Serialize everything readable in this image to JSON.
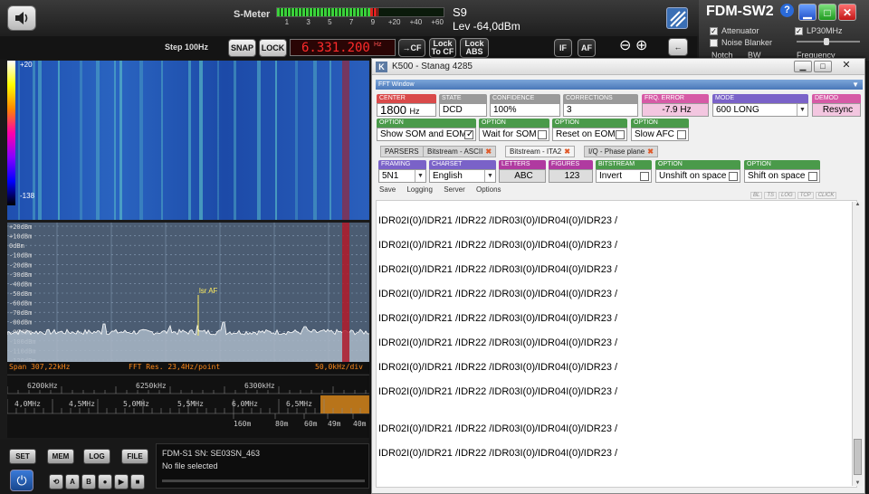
{
  "sdr": {
    "smeter_label": "S-Meter",
    "smeter_scale": [
      "1",
      "3",
      "5",
      "7",
      "9",
      "+20",
      "+40",
      "+60"
    ],
    "smeter_level": 0.62,
    "s_level": "S9",
    "level_dbm": "Lev -64,0dBm",
    "step": "Step 100Hz",
    "snap": "SNAP",
    "lock": "LOCK",
    "frequency": "6.331.200",
    "freq_unit": "Hz",
    "to_cf": "CF",
    "lock_to_cf": "Lock To CF",
    "lock_abs": "Lock ABS",
    "if_btn": "IF",
    "af_btn": "AF",
    "wf_top": "+20",
    "wf_bottom": "-138",
    "spec_db": [
      "+20dBm",
      "+10dBm",
      "0dBm",
      "-10dBm",
      "-20dBm",
      "-30dBm",
      "-40dBm",
      "-50dBm",
      "-60dBm",
      "-70dBm",
      "-80dBm",
      "-90dBm",
      "-100dBm",
      "-110dBm",
      "-120dBm"
    ],
    "marker_label": "lsr AF",
    "span": "Span 307,22kHz",
    "fft_res": "FFT Res. 23,4Hz/point",
    "div": "50,0kHz/div",
    "khz_ticks": [
      "6200kHz",
      "6250kHz",
      "6300kHz"
    ],
    "mhz_ticks": [
      "4,0MHz",
      "4,5MHz",
      "5,0MHz",
      "5,5MHz",
      "6,0MHz",
      "6,5MHz"
    ],
    "band_ticks": [
      "160m",
      "80m",
      "60m",
      "49m",
      "40m"
    ],
    "set": "SET",
    "mem": "MEM",
    "log": "LOG",
    "file": "FILE",
    "device": "FDM-S1 SN: SE03SN_463",
    "file_status": "No file selected"
  },
  "fdm": {
    "title": "FDM-SW2",
    "help": "?",
    "attenuator": "Attenuator",
    "lp30": "LP30MHz",
    "noise_blanker": "Noise Blanker",
    "notch": "Notch",
    "bw": "BW",
    "frequency": "Frequency"
  },
  "k500": {
    "title": "K500 - Stanag 4285",
    "fft_window": "FFT Window",
    "center_label": "CENTER",
    "center_value": "1800",
    "center_unit": "Hz",
    "state_label": "STATE",
    "state_value": "DCD",
    "confidence_label": "CONFIDENCE",
    "confidence_value": "100%",
    "corrections_label": "CORRECTIONS",
    "corrections_value": "3",
    "frq_error_label": "FRQ. ERROR",
    "frq_error_value": "-7.9 Hz",
    "mode_label": "MODE",
    "mode_value": "600 LONG",
    "demod_label": "DEMOD",
    "demod_value": "Resync",
    "option_label": "OPTION",
    "show_som": "Show SOM and EOM",
    "wait_som": "Wait for SOM",
    "reset_eom": "Reset on EOM",
    "slow_afc": "Slow AFC",
    "tabs": [
      "PARSERS",
      "Bitstream - ASCII",
      "Bitstream - ITA2",
      "I/Q - Phase plane"
    ],
    "framing_label": "FRAMING",
    "framing_value": "5N1",
    "charset_label": "CHARSET",
    "charset_value": "English",
    "letters_label": "LETTERS",
    "letters_value": "ABC",
    "figures_label": "FIGURES",
    "figures_value": "123",
    "bitstream_label": "BITSTREAM",
    "bitstream_value": "Invert",
    "unshift": "Unshift on space",
    "shift": "Shift on space",
    "subnav": [
      "Save",
      "Logging",
      "Server",
      "Options"
    ],
    "tiny": [
      "BL",
      "TS",
      "LOG",
      "TCP",
      "CLICK"
    ],
    "lines": [
      "IDR02I(0)/IDR21 /IDR22 /IDR03I(0)/IDR04I(0)/IDR23 /",
      "IDR02I(0)/IDR21 /IDR22 /IDR03I(0)/IDR04I(0)/IDR23 /",
      "IDR02I(0)/IDR21 /IDR22 /IDR03I(0)/IDR04I(0)/IDR23 /",
      "IDR02I(0)/IDR21 /IDR22 /IDR03I(0)/IDR04I(0)/IDR23 /",
      "IDR02I(0)/IDR21 /IDR22 /IDR03I(0)/IDR04I(0)/IDR23 /",
      "IDR02I(0)/IDR21 /IDR22 /IDR03I(0)/IDR04I(0)/IDR23 /",
      "IDR02I(0)/IDR21 /IDR22 /IDR03I(0)/IDR04I(0)/IDR23 /",
      "IDR02I(0)/IDR21 /IDR22 /IDR03I(0)/IDR04I(0)/IDR23 /",
      "IDR02I(0)/IDR21 /IDR22 /IDR03I(0)/IDR04I(0)/IDR23 /",
      "IDR02I(0)/IDR21 /IDR22 /IDR03I(0)/IDR04I(0)/IDR23 /"
    ]
  }
}
